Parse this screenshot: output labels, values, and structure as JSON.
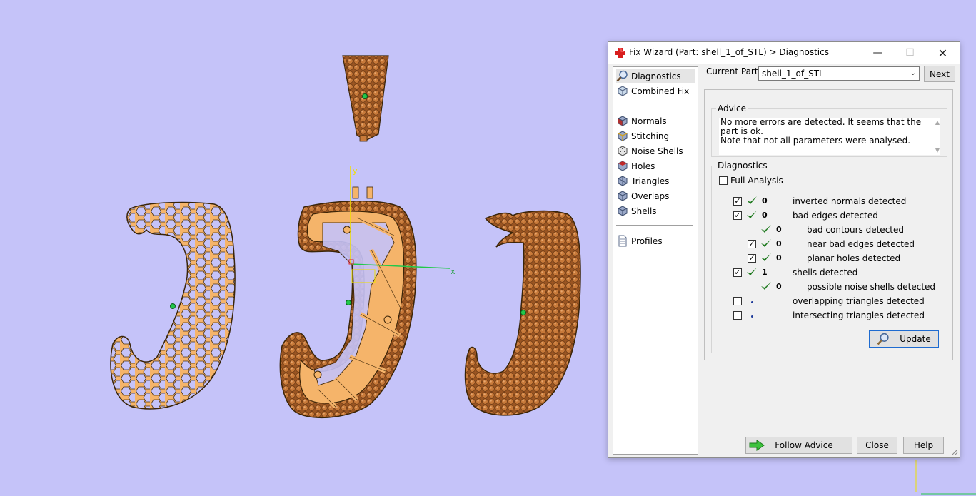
{
  "window": {
    "title": "Fix Wizard (Part: shell_1_of_STL) > Diagnostics",
    "minimize": "—",
    "maximize": "☐",
    "close": "✕"
  },
  "nav": {
    "items": [
      {
        "label": "Diagnostics",
        "icon": "magnifier-icon"
      },
      {
        "label": "Combined Fix",
        "icon": "cube-icon"
      },
      {
        "label": "Normals",
        "icon": "cube-icon"
      },
      {
        "label": "Stitching",
        "icon": "cube-icon"
      },
      {
        "label": "Noise Shells",
        "icon": "dice-icon"
      },
      {
        "label": "Holes",
        "icon": "cube-icon"
      },
      {
        "label": "Triangles",
        "icon": "triangle-cube-icon"
      },
      {
        "label": "Overlaps",
        "icon": "cube-icon"
      },
      {
        "label": "Shells",
        "icon": "cube-icon"
      },
      {
        "label": "Profiles",
        "icon": "document-icon"
      }
    ]
  },
  "current_part": {
    "label": "Current Part:",
    "value": "shell_1_of_STL",
    "next": "Next"
  },
  "advice": {
    "title": "Advice",
    "line1": "No more errors are detected. It seems that the part is ok.",
    "line2": "Note that not all parameters were analysed."
  },
  "diagnostics": {
    "title": "Diagnostics",
    "full_analysis": "Full Analysis",
    "rows": [
      {
        "checkbox": "checked",
        "status": "ok",
        "count": "0",
        "text": "inverted normals detected"
      },
      {
        "checkbox": "checked",
        "status": "ok",
        "count": "0",
        "text": "bad edges detected"
      },
      {
        "checkbox": "none",
        "status": "ok",
        "count": "0",
        "text": "bad contours detected"
      },
      {
        "checkbox": "checked",
        "status": "ok",
        "count": "0",
        "text": "near bad edges detected"
      },
      {
        "checkbox": "checked",
        "status": "ok",
        "count": "0",
        "text": "planar holes detected"
      },
      {
        "checkbox": "checked",
        "status": "ok",
        "count": "1",
        "text": "shells detected"
      },
      {
        "checkbox": "none",
        "status": "ok",
        "count": "0",
        "text": "possible noise shells detected"
      },
      {
        "checkbox": "unchecked",
        "status": "pending",
        "count": "",
        "text": "overlapping triangles detected"
      },
      {
        "checkbox": "unchecked",
        "status": "pending",
        "count": "",
        "text": "intersecting triangles detected"
      }
    ],
    "update": "Update"
  },
  "buttons": {
    "follow_advice": "Follow Advice",
    "close": "Close",
    "help": "Help"
  },
  "viewport": {
    "axis_y": "y",
    "axis_x": "x",
    "background": "#c5c3f9",
    "part_color": "#f5b46a",
    "stone_color": "#b5652b",
    "check_color": "#1f7a1f"
  }
}
